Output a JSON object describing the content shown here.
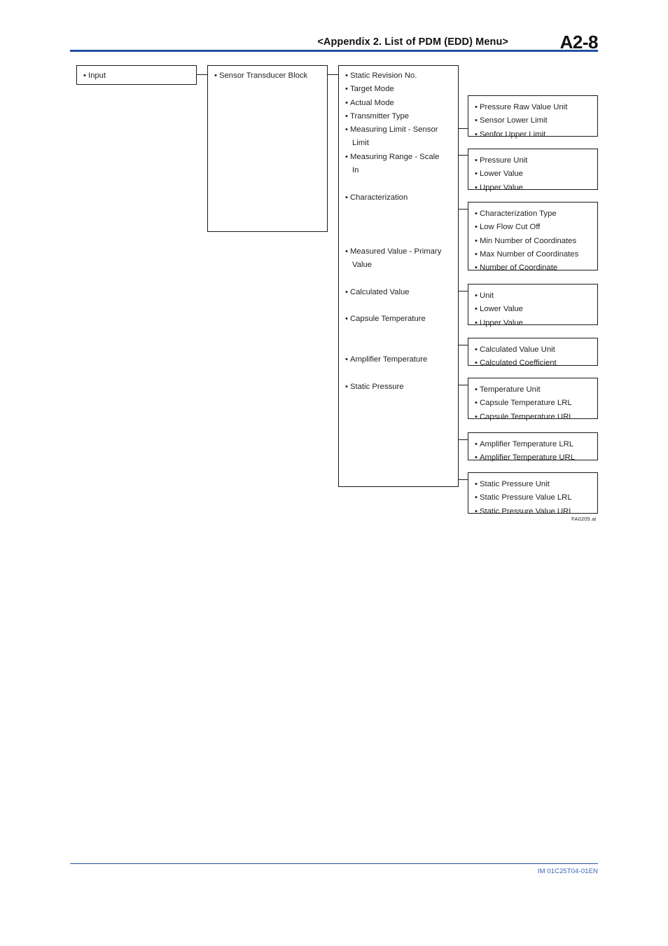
{
  "header": {
    "title": "<Appendix 2.  List of PDM (EDD) Menu>",
    "page_number": "A2-8",
    "rule_color": "#2450a0"
  },
  "footer": {
    "document_code": "IM 01C25T04-01EN",
    "code_color": "#3763b4"
  },
  "figure": {
    "label": "FA0205.ai"
  },
  "diagram": {
    "column1": {
      "items": [
        "Input"
      ]
    },
    "column2": {
      "items": [
        "Sensor Transducer Block"
      ]
    },
    "column3": {
      "items": [
        "Static Revision No.",
        "Target Mode",
        "Actual Mode",
        "Transmitter Type",
        "Measuring Limit - Sensor",
        "Limit",
        "Measuring Range - Scale",
        "In",
        "Characterization",
        "Measured Value - Primary",
        "Value",
        "Calculated Value",
        "Capsule Temperature",
        "Amplifier Temperature",
        "Static Pressure"
      ]
    },
    "column4": {
      "groups": [
        {
          "name": "sensor-limits",
          "items": [
            "Pressure Raw Value Unit",
            "Sensor Lower Limit",
            "Senfor Upper Limit"
          ]
        },
        {
          "name": "scale-in",
          "items": [
            "Pressure Unit",
            "Lower Value",
            "Upper Value"
          ]
        },
        {
          "name": "characterization",
          "items": [
            "Characterization Type",
            "Low Flow Cut Off",
            "Min Number of Coordinates",
            "Max Number of Coordinates",
            "Number of Coordinate"
          ]
        },
        {
          "name": "primary-value",
          "items": [
            "Unit",
            "Lower Value",
            "Upper Value"
          ]
        },
        {
          "name": "calculated-value",
          "items": [
            "Calculated Value Unit",
            "Calculated Coefficient"
          ]
        },
        {
          "name": "capsule-temperature",
          "items": [
            "Temperature Unit",
            "Capsule Temperature LRL",
            "Capsule Temperature URL"
          ]
        },
        {
          "name": "amplifier-temperature",
          "items": [
            "Amplifier Temperature LRL",
            "Amplifier Temperature URL"
          ]
        },
        {
          "name": "static-pressure",
          "items": [
            "Static Pressure Unit",
            "Static Pressure Value LRL",
            "Static Pressure Value URL"
          ]
        }
      ]
    }
  }
}
